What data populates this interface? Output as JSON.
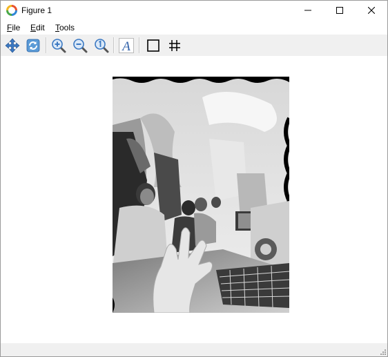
{
  "window": {
    "title": "Figure 1"
  },
  "menu": {
    "file": {
      "mnemonic": "F",
      "rest": "ile"
    },
    "edit": {
      "mnemonic": "E",
      "rest": "dit"
    },
    "tools": {
      "mnemonic": "T",
      "rest": "ools"
    }
  },
  "toolbar": {
    "icons": [
      "pan-icon",
      "reset-view-icon",
      "zoom-in-icon",
      "zoom-out-icon",
      "zoom-fit-icon",
      "text-tool-icon",
      "frame-icon",
      "grid-icon"
    ],
    "text_tool_glyph": "A"
  },
  "figure": {
    "image_mode": "grayscale"
  },
  "statusbar": {
    "text": ""
  },
  "colors": {
    "toolbar_bg": "#f0f0f0",
    "icon_blue": "#3a78c2",
    "photo_border": "#000000"
  }
}
